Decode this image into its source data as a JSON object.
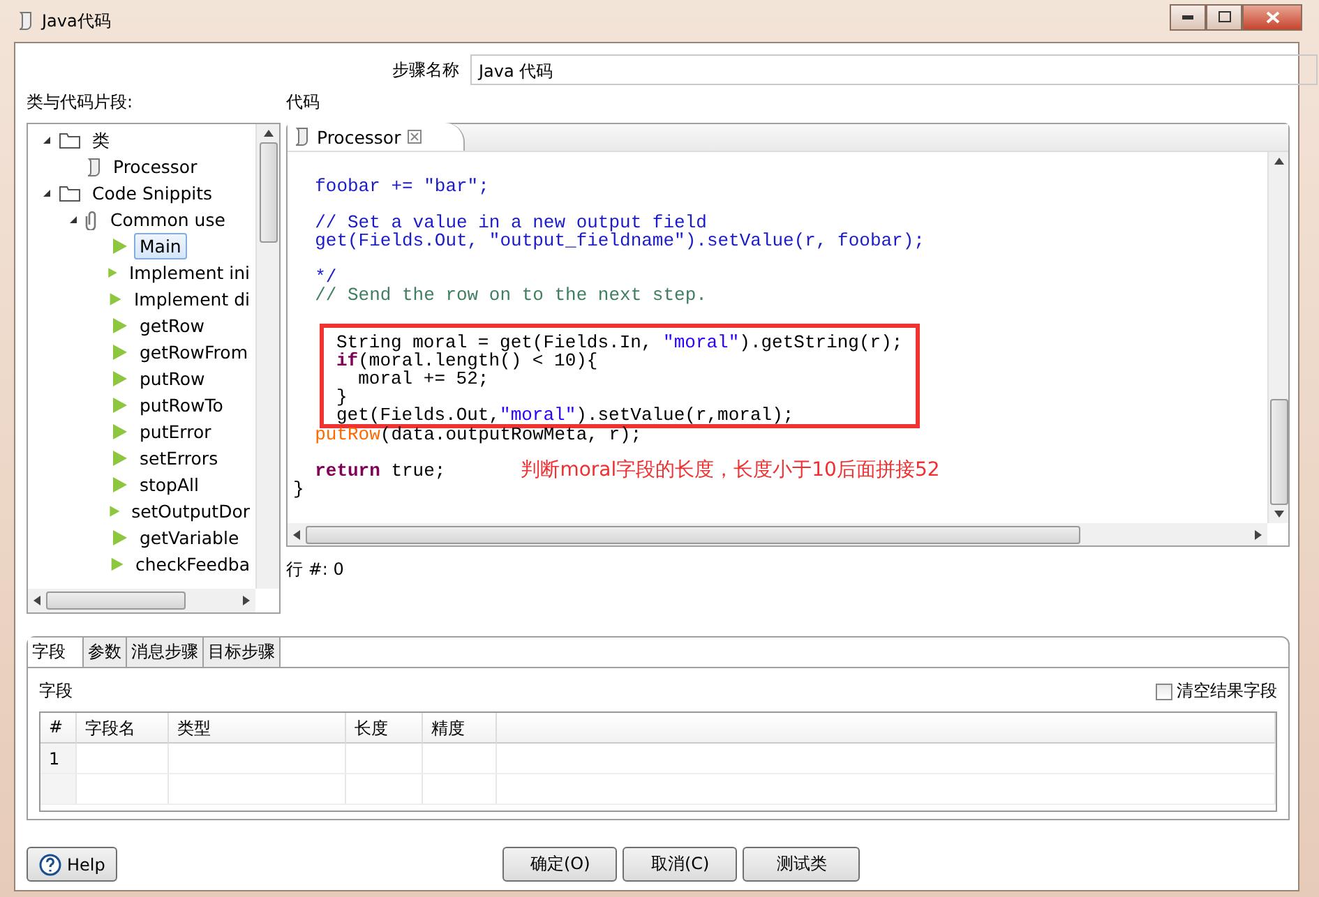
{
  "window": {
    "title": "Java代码"
  },
  "step_name": {
    "label": "步骤名称",
    "value": "Java 代码"
  },
  "tree": {
    "label": "类与代码片段:",
    "items": [
      {
        "label": "类",
        "kind": "folder",
        "expanded": true,
        "selected": false,
        "children": [
          {
            "label": "Processor",
            "kind": "script",
            "selected": false
          }
        ]
      },
      {
        "label": "Code Snippits",
        "kind": "folder",
        "expanded": true,
        "selected": false,
        "children": [
          {
            "label": "Common use",
            "kind": "clip",
            "expanded": true,
            "selected": false,
            "children": [
              {
                "label": "Main",
                "kind": "snippet",
                "selected": true
              },
              {
                "label": "Implement ini",
                "kind": "snippet",
                "selected": false
              },
              {
                "label": "Implement di",
                "kind": "snippet",
                "selected": false
              },
              {
                "label": "getRow",
                "kind": "snippet",
                "selected": false
              },
              {
                "label": "getRowFrom",
                "kind": "snippet",
                "selected": false
              },
              {
                "label": "putRow",
                "kind": "snippet",
                "selected": false
              },
              {
                "label": "putRowTo",
                "kind": "snippet",
                "selected": false
              },
              {
                "label": "putError",
                "kind": "snippet",
                "selected": false
              },
              {
                "label": "setErrors",
                "kind": "snippet",
                "selected": false
              },
              {
                "label": "stopAll",
                "kind": "snippet",
                "selected": false
              },
              {
                "label": "setOutputDor",
                "kind": "snippet",
                "selected": false
              },
              {
                "label": "getVariable",
                "kind": "snippet",
                "selected": false
              },
              {
                "label": "checkFeedba",
                "kind": "snippet",
                "selected": false
              }
            ]
          }
        ]
      }
    ]
  },
  "editor": {
    "label": "代码",
    "tab": {
      "label": "Processor",
      "selected": true
    },
    "lines": [
      {
        "boxed": false,
        "indent": true,
        "tokens": [
          {
            "kind": "block",
            "text": "foobar += \"bar\";"
          }
        ]
      },
      {
        "boxed": false
      },
      {
        "boxed": false,
        "indent": true,
        "tokens": [
          {
            "kind": "block",
            "text": "// Set a value in a new output field"
          }
        ]
      },
      {
        "boxed": false,
        "indent": true,
        "tokens": [
          {
            "kind": "block",
            "text": "get(Fields.Out, \"output_fieldname\").setValue(r, foobar);"
          }
        ]
      },
      {
        "boxed": false
      },
      {
        "boxed": false,
        "indent": true,
        "tokens": [
          {
            "kind": "block",
            "text": "*/"
          }
        ]
      },
      {
        "boxed": false,
        "indent": true,
        "tokens": [
          {
            "kind": "comment",
            "text": "// Send the row on to the next step."
          }
        ]
      },
      {
        "boxed": false
      },
      {
        "boxed": true,
        "indent": false,
        "tokens": [
          {
            "kind": "plain",
            "text": "String moral = get(Fields.In, "
          },
          {
            "kind": "string",
            "text": "\"moral\""
          },
          {
            "kind": "plain",
            "text": ").getString(r);"
          }
        ]
      },
      {
        "boxed": true,
        "indent": false,
        "tokens": [
          {
            "kind": "keyword",
            "text": "if"
          },
          {
            "kind": "plain",
            "text": "(moral.length() < 10){"
          }
        ]
      },
      {
        "boxed": true,
        "indent": true,
        "tokens": [
          {
            "kind": "plain",
            "text": "moral += 52;"
          }
        ]
      },
      {
        "boxed": true,
        "indent": false,
        "tokens": [
          {
            "kind": "plain",
            "text": "}"
          }
        ]
      },
      {
        "boxed": true,
        "indent": false,
        "tokens": [
          {
            "kind": "plain",
            "text": "get(Fields.Out,"
          },
          {
            "kind": "string",
            "text": "\"moral\""
          },
          {
            "kind": "plain",
            "text": ").setValue(r,moral);"
          }
        ]
      },
      {
        "boxed": false,
        "indent": true,
        "tokens": [
          {
            "kind": "method",
            "text": "putRow"
          },
          {
            "kind": "plain",
            "text": "(data.outputRowMeta, r);"
          }
        ]
      },
      {
        "boxed": false
      },
      {
        "boxed": false,
        "indent": true,
        "tokens": [
          {
            "kind": "keyword",
            "text": "return"
          },
          {
            "kind": "plain",
            "text": " true;"
          }
        ],
        "note": "判断moral字段的长度，长度小于10后面拼接52"
      },
      {
        "boxed": false,
        "indent": false,
        "tokens": [
          {
            "kind": "plain",
            "text": "}"
          }
        ]
      }
    ],
    "row_status": "行 #: 0"
  },
  "bottom_tabs": [
    {
      "label": "字段",
      "selected": true
    },
    {
      "label": "参数",
      "selected": false
    },
    {
      "label": "消息步骤",
      "selected": false
    },
    {
      "label": "目标步骤",
      "selected": false
    }
  ],
  "fields": {
    "label": "字段",
    "clear_option": {
      "label": "清空结果字段",
      "checked": false
    },
    "columns": [
      "#",
      "字段名",
      "类型",
      "长度",
      "精度"
    ],
    "rows": [
      {
        "number": "1"
      }
    ]
  },
  "help_button": "Help",
  "buttons": [
    "确定(O)",
    "取消(C)",
    "测试类"
  ]
}
